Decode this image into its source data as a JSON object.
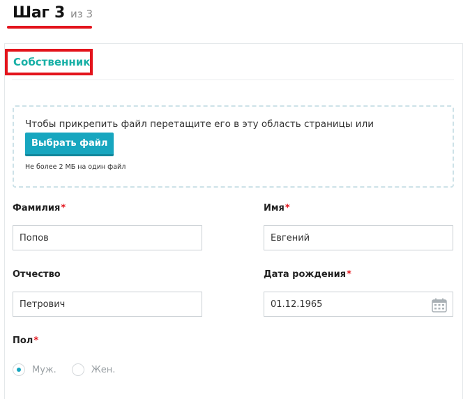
{
  "step": {
    "title": "Шаг 3",
    "of": "из 3"
  },
  "section": {
    "title": "Собственник"
  },
  "upload": {
    "instruction": "Чтобы прикрепить файл перетащите его в эту область страницы или",
    "button_label": "Выбрать файл",
    "limit_note": "Не более 2 МБ на один файл"
  },
  "fields": {
    "last_name": {
      "label": "Фамилия",
      "required_mark": "*",
      "value": "Попов"
    },
    "first_name": {
      "label": "Имя",
      "required_mark": "*",
      "value": "Евгений"
    },
    "patronymic": {
      "label": "Отчество",
      "value": "Петрович"
    },
    "birth_date": {
      "label": "Дата рождения",
      "required_mark": "*",
      "value": "01.12.1965",
      "icon": "calendar-icon"
    },
    "gender": {
      "label": "Пол",
      "required_mark": "*",
      "options": [
        {
          "label": "Муж.",
          "selected": true
        },
        {
          "label": "Жен.",
          "selected": false
        }
      ]
    }
  },
  "colors": {
    "accent_red": "#e3141c",
    "section_teal": "#18b0a6",
    "button_blue": "#17a6bf"
  }
}
